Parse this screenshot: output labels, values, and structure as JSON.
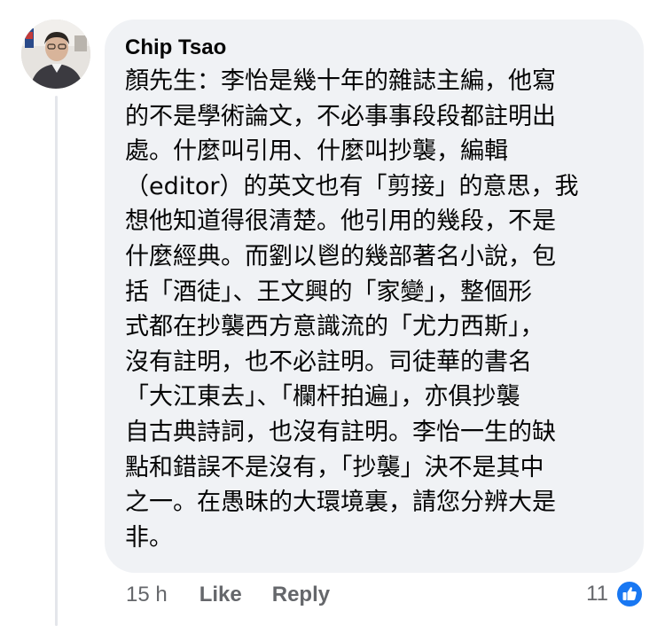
{
  "comment": {
    "author": "Chip Tsao",
    "lines": [
      "顏先生：李怡是幾十年的雜誌主編，他寫",
      "的不是學術論文，不必事事段段都註明出",
      "處。什麼叫引用、什麼叫抄襲，編輯",
      "（editor）的英文也有「剪接」的意思，我",
      "想他知道得很清楚。他引用的幾段，不是",
      "什麼經典。而劉以鬯的幾部著名小說，包",
      "括「酒徒」、王文興的「家變」，整個形",
      "式都在抄襲西方意識流的「尤力西斯」，",
      "沒有註明，也不必註明。司徒華的書名",
      "「大江東去」、「欄杆拍遍」，亦俱抄襲",
      "自古典詩詞，也沒有註明。李怡一生的缺",
      "點和錯誤不是沒有，「抄襲」決不是其中",
      "之一。在愚昧的大環境裏，請您分辨大是",
      "非。"
    ],
    "timestamp": "15 h",
    "like_label": "Like",
    "reply_label": "Reply",
    "reaction_count": "11",
    "reaction_icon": "like-thumbs-up-icon"
  },
  "colors": {
    "bubble_bg": "#f0f2f5",
    "text": "#050505",
    "meta_text": "#65676b",
    "like_blue": "#1877f2"
  }
}
